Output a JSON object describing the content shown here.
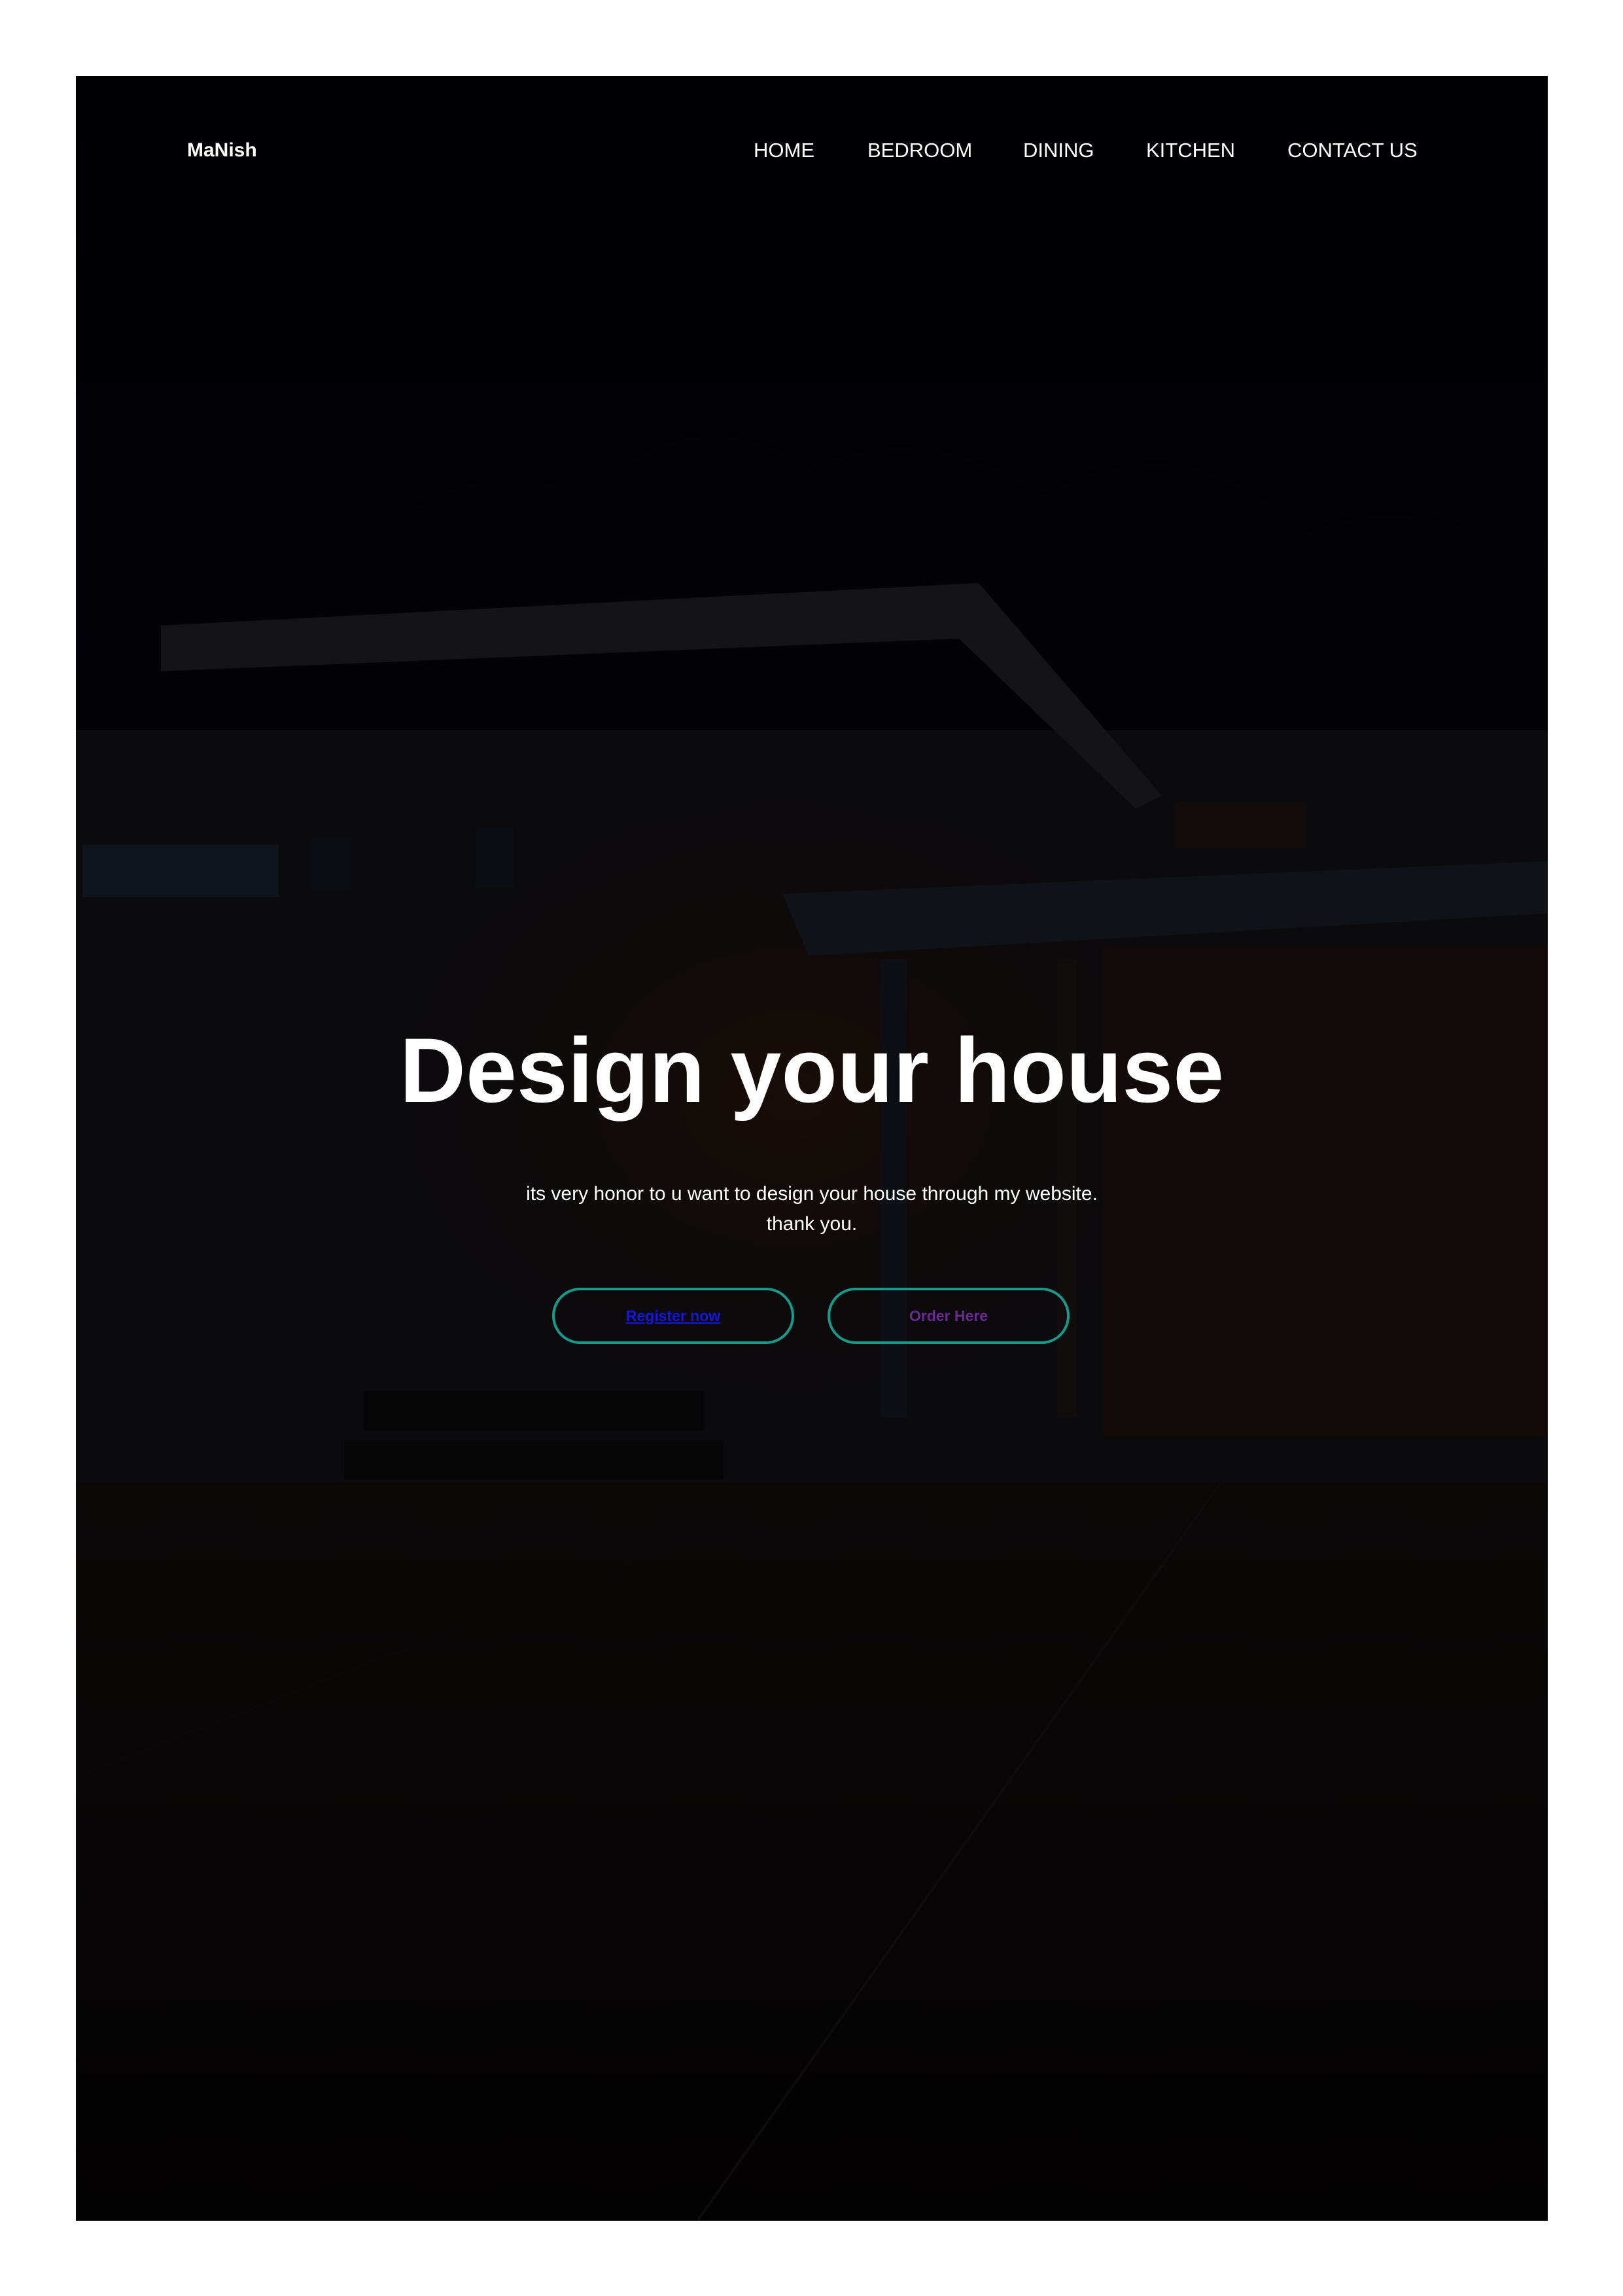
{
  "brand": {
    "logo_text": "MaNish"
  },
  "nav": {
    "items": [
      {
        "label": "HOME"
      },
      {
        "label": "BEDROOM"
      },
      {
        "label": "DINING"
      },
      {
        "label": "KITCHEN"
      },
      {
        "label": "CONTACT US"
      }
    ]
  },
  "hero": {
    "title": "Design your house",
    "description_line1": "its very honor to u want to design your house through my website.",
    "description_line2": "thank you.",
    "primary_button": "Register now",
    "secondary_button": "Order Here",
    "background": "dimmed photo of a modern house at night"
  },
  "colors": {
    "button_border": "#159a8c",
    "link_blue": "#1515e6",
    "link_visited": "#6a2a95",
    "text": "#ffffff",
    "background": "#020203"
  }
}
